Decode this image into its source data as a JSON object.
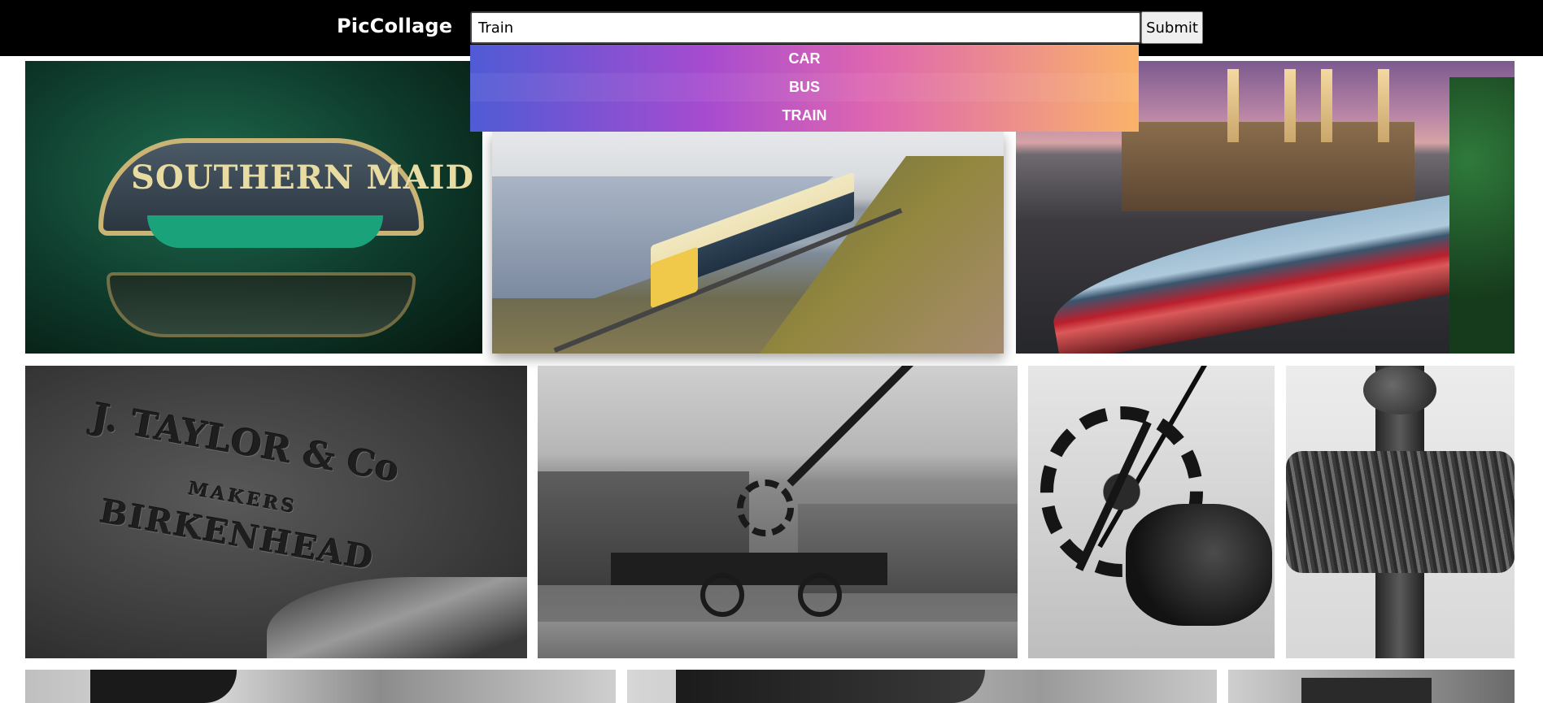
{
  "header": {
    "brand": "PicCollage",
    "search": {
      "value": "Train",
      "placeholder": ""
    },
    "submit_label": "Submit"
  },
  "suggestions": [
    "CAR",
    "BUS",
    "TRAIN"
  ],
  "colors": {
    "header_bg": "#000000",
    "dropdown_gradient": [
      "#4f5bd5",
      "#a64bd0",
      "#de66b0",
      "#fab36a"
    ]
  },
  "gallery": {
    "tiles": [
      {
        "name": "photo-southern-maid-nameplate",
        "text": "SOUTHERN MAID"
      },
      {
        "name": "photo-train-by-river"
      },
      {
        "name": "photo-battersea-light-trails"
      },
      {
        "name": "photo-taylor-birkenhead-casting",
        "lines": [
          "J. TAYLOR & Co",
          "MAKERS",
          "BIRKENHEAD"
        ]
      },
      {
        "name": "photo-dockside-crane"
      },
      {
        "name": "photo-crane-gear-wheel"
      },
      {
        "name": "photo-cable-drum"
      },
      {
        "name": "photo-machinery-1"
      },
      {
        "name": "photo-machinery-2"
      },
      {
        "name": "photo-machinery-3"
      }
    ]
  }
}
